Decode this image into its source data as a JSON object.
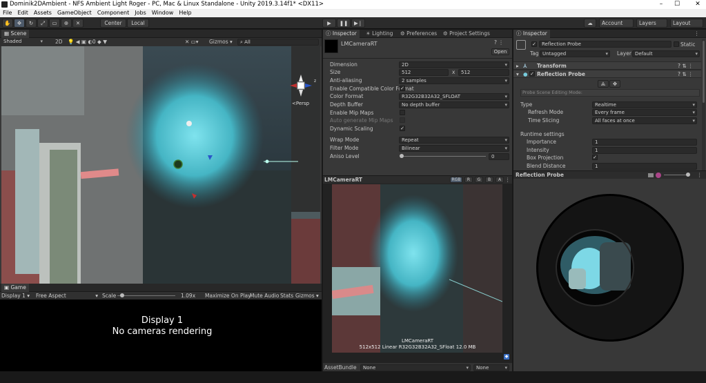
{
  "window": {
    "title": "Dominik2DAmbient - NFS Ambient Light Roger - PC, Mac & Linux Standalone - Unity 2019.3.14f1* <DX11>",
    "minimize": "–",
    "maximize": "☐",
    "close": "✕"
  },
  "menu": [
    "File",
    "Edit",
    "Assets",
    "GameObject",
    "Component",
    "Jobs",
    "Window",
    "Help"
  ],
  "toolbar": {
    "tools": [
      "hand-tool",
      "move-tool",
      "rotate-tool",
      "scale-tool",
      "rect-tool",
      "transform-tool",
      "custom-tool"
    ],
    "pivot": "Center",
    "space": "Local",
    "play": "play",
    "pause": "pause",
    "step": "step",
    "account": "Account",
    "layers": "Layers",
    "layout": "Layout"
  },
  "scene": {
    "tab": "Scene",
    "shading": "Shaded",
    "mode2d": "2D",
    "gizmos": "Gizmos",
    "search": "All",
    "persp": "<Persp",
    "gizmo_axes": {
      "y": "y",
      "z": "z",
      "x": "x"
    }
  },
  "game": {
    "tab": "Game",
    "display": "Display 1",
    "aspect": "Free Aspect",
    "scale_label": "Scale",
    "scale_value": "1.09x",
    "maximize": "Maximize On Play",
    "mute": "Mute Audio",
    "stats": "Stats",
    "gizmos": "Gizmos",
    "line1": "Display 1",
    "line2": "No cameras rendering"
  },
  "inspector_mid": {
    "tabs": [
      "Inspector",
      "Lighting",
      "Preferences",
      "Project Settings"
    ],
    "asset_name": "LMCameraRT",
    "open": "Open",
    "props": {
      "dimension": {
        "label": "Dimension",
        "value": "2D"
      },
      "size": {
        "label": "Size",
        "w": "512",
        "x": "x",
        "h": "512"
      },
      "anti": {
        "label": "Anti-aliasing",
        "value": "2 samples"
      },
      "compat": {
        "label": "Enable Compatible Color Format",
        "checked": "✓"
      },
      "colorformat": {
        "label": "Color Format",
        "value": "R32G32B32A32_SFLOAT"
      },
      "depth": {
        "label": "Depth Buffer",
        "value": "No depth buffer"
      },
      "mip": {
        "label": "Enable Mip Maps"
      },
      "automip": {
        "label": "Auto generate Mip Maps"
      },
      "dyn": {
        "label": "Dynamic Scaling",
        "checked": "✓"
      },
      "wrap": {
        "label": "Wrap Mode",
        "value": "Repeat"
      },
      "filter": {
        "label": "Filter Mode",
        "value": "Bilinear"
      },
      "aniso": {
        "label": "Aniso Level",
        "value": "0"
      }
    },
    "preview": {
      "title": "LMCameraRT",
      "channels": [
        "RGB",
        "R",
        "G",
        "B",
        "A"
      ],
      "caption1": "LMCameraRT",
      "caption2": "512x512 Linear  R32G32B32A32_SFloat  12.0 MB"
    },
    "assetbundle": {
      "label": "AssetBundle",
      "name": "None",
      "variant": "None"
    }
  },
  "inspector_right": {
    "tab": "Inspector",
    "object_name": "Reflection Probe",
    "static": "Static",
    "tag_label": "Tag",
    "tag": "Untagged",
    "layer_label": "Layer",
    "layer": "Default",
    "transform": "Transform",
    "component": "Reflection Probe",
    "edit_mode": "Probe Scene Editing Mode:",
    "type": {
      "label": "Type",
      "value": "Realtime"
    },
    "refresh": {
      "label": "Refresh Mode",
      "value": "Every frame"
    },
    "slicing": {
      "label": "Time Slicing",
      "value": "All faces at once"
    },
    "runtime": "Runtime settings",
    "importance": {
      "label": "Importance",
      "value": "1"
    },
    "intensity": {
      "label": "Intensity",
      "value": "1"
    },
    "box": {
      "label": "Box Projection",
      "checked": "✓"
    },
    "blend": {
      "label": "Blend Distance",
      "value": "1"
    },
    "preview_title": "Reflection Probe"
  }
}
